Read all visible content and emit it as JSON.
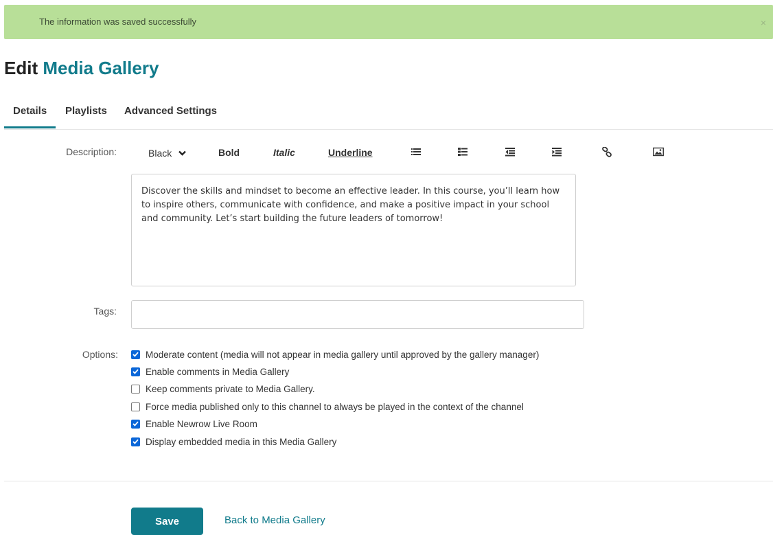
{
  "alert": {
    "message": "The information was saved successfully",
    "close_symbol": "×",
    "color": "#b8df98"
  },
  "page_title": {
    "prefix": "Edit",
    "name": "Media Gallery",
    "accent_color": "#117b8b"
  },
  "tabs": [
    {
      "label": "Details",
      "active": true
    },
    {
      "label": "Playlists",
      "active": false
    },
    {
      "label": "Advanced Settings",
      "active": false
    }
  ],
  "description": {
    "label": "Description:",
    "toolbar": {
      "color_select": "Black",
      "bold": "Bold",
      "italic": "Italic",
      "underline": "Underline",
      "icons": [
        "bulleted-list-icon",
        "numbered-list-icon",
        "outdent-icon",
        "indent-icon",
        "link-icon",
        "image-icon"
      ]
    },
    "text": "Discover the skills and mindset to become an effective leader. In this course, you’ll learn how to inspire others, communicate with confidence, and make a positive impact in your school and community. Let’s start building the future leaders of tomorrow!"
  },
  "tags": {
    "label": "Tags:",
    "value": ""
  },
  "options": {
    "label": "Options:",
    "items": [
      {
        "label": "Moderate content (media will not appear in media gallery until approved by the gallery manager)",
        "checked": true
      },
      {
        "label": "Enable comments in Media Gallery",
        "checked": true
      },
      {
        "label": "Keep comments private to Media Gallery.",
        "checked": false
      },
      {
        "label": "Force media published only to this channel to always be played in the context of the channel",
        "checked": false
      },
      {
        "label": "Enable Newrow Live Room",
        "checked": true
      },
      {
        "label": "Display embedded media in this Media Gallery",
        "checked": true
      }
    ]
  },
  "actions": {
    "save": "Save",
    "back": "Back to Media Gallery"
  }
}
